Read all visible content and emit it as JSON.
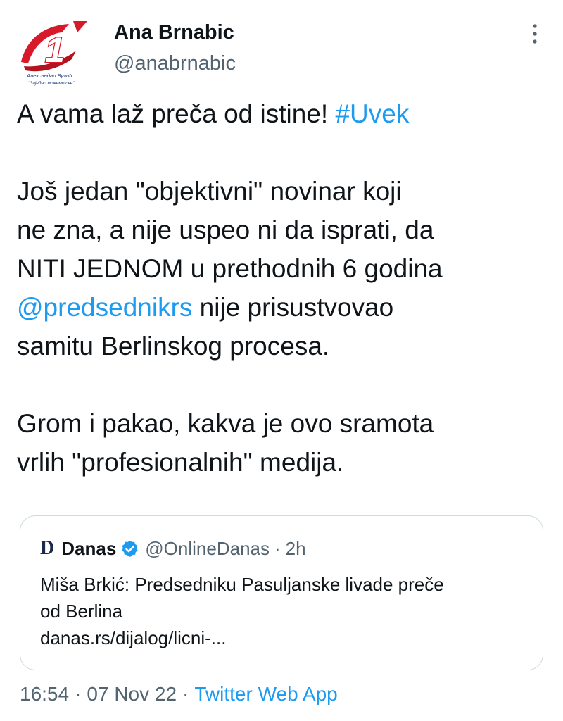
{
  "author": {
    "name": "Ana Brnabic",
    "handle": "@anabrnabic",
    "avatar": {
      "logo_text": "1",
      "caption_line1": "Александар Вучић",
      "caption_line2": "\"Заједно можемо све\"",
      "accent_color": "#d7192a"
    }
  },
  "tweet": {
    "lines": {
      "l1_text": "A vama laž preča od istine! ",
      "l1_hashtag": "#Uvek",
      "l3": "Još jedan \"objektivni\" novinar koji",
      "l4": "ne zna, a nije uspeo ni da isprati, da",
      "l5": "NITI JEDNOM u prethodnih 6 godina",
      "l6_mention": "@predsednikrs",
      "l6_text": " nije prisustvovao",
      "l7": "samitu Berlinskog procesa.",
      "l9": "Grom i pakao, kakva je ovo sramota",
      "l10": "vrlih \"profesionalnih\" medija."
    }
  },
  "quote": {
    "logo": "D",
    "name": "Danas",
    "handle": "@OnlineDanas",
    "separator": "·",
    "time": "2h",
    "body_line1": "Miša Brkić: Predsedniku Pasuljanske livade preče",
    "body_line2": "od Berlina",
    "url": "danas.rs/dijalog/licni-..."
  },
  "meta": {
    "time": "16:54",
    "separator": "·",
    "date": "07 Nov 22",
    "source": "Twitter Web App"
  },
  "colors": {
    "link": "#1d9bf0",
    "text": "#0f1419",
    "muted": "#536471",
    "border": "#cfd9de",
    "verified": "#1d9bf0"
  },
  "icons": {
    "more": "more-vertical-icon",
    "verified": "verified-badge-icon"
  }
}
